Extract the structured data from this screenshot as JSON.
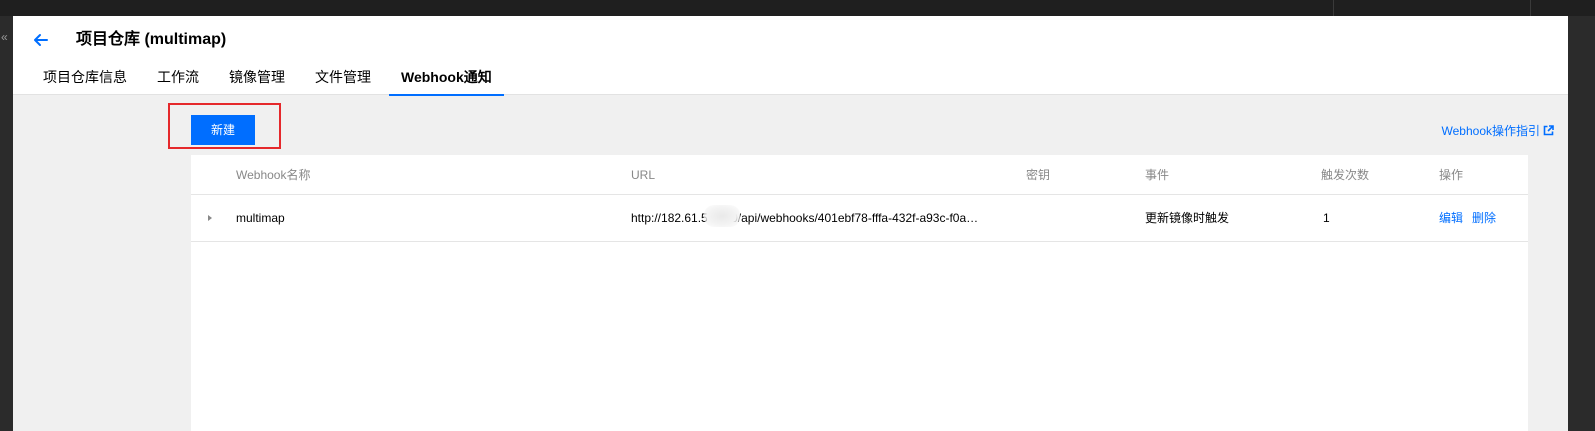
{
  "header": {
    "title": "项目仓库 (multimap)",
    "tabs": [
      {
        "label": "项目仓库信息"
      },
      {
        "label": "工作流"
      },
      {
        "label": "镜像管理"
      },
      {
        "label": "文件管理"
      },
      {
        "label": "Webhook通知",
        "active": true
      }
    ]
  },
  "toolbar": {
    "create_label": "新建",
    "guide_label": "Webhook操作指引"
  },
  "table": {
    "columns": [
      "Webhook名称",
      "URL",
      "密钥",
      "事件",
      "触发次数",
      "操作"
    ],
    "rows": [
      {
        "name": "multimap",
        "url": "http://182.61.5 9000/api/webhooks/401ebf78-fffa-432f-a93c-f0a…",
        "secret": "",
        "event": "更新镜像时触发",
        "trigger_count": "1",
        "edit_label": "编辑",
        "delete_label": "删除"
      }
    ]
  },
  "colors": {
    "accent": "#006eff",
    "highlight": "#e5282b"
  }
}
